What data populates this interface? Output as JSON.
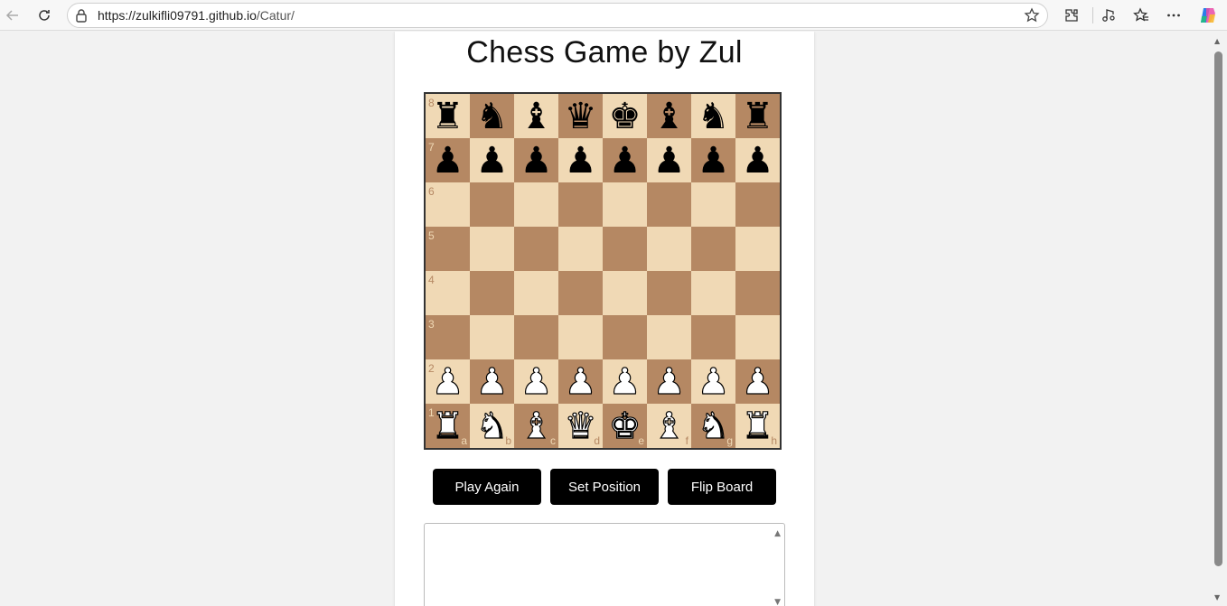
{
  "browser": {
    "url_host": "https://zulkifli09791.github.io",
    "url_path": "/Catur/"
  },
  "page": {
    "title": "Chess Game by Zul"
  },
  "board": {
    "rank_labels": [
      "8",
      "7",
      "6",
      "5",
      "4",
      "3",
      "2",
      "1"
    ],
    "file_labels": [
      "a",
      "b",
      "c",
      "d",
      "e",
      "f",
      "g",
      "h"
    ],
    "position": [
      [
        "bR",
        "bN",
        "bB",
        "bQ",
        "bK",
        "bB",
        "bN",
        "bR"
      ],
      [
        "bP",
        "bP",
        "bP",
        "bP",
        "bP",
        "bP",
        "bP",
        "bP"
      ],
      [
        "",
        "",
        "",
        "",
        "",
        "",
        "",
        ""
      ],
      [
        "",
        "",
        "",
        "",
        "",
        "",
        "",
        ""
      ],
      [
        "",
        "",
        "",
        "",
        "",
        "",
        "",
        ""
      ],
      [
        "",
        "",
        "",
        "",
        "",
        "",
        "",
        ""
      ],
      [
        "wP",
        "wP",
        "wP",
        "wP",
        "wP",
        "wP",
        "wP",
        "wP"
      ],
      [
        "wR",
        "wN",
        "wB",
        "wQ",
        "wK",
        "wB",
        "wN",
        "wR"
      ]
    ],
    "light_color": "#f0d9b5",
    "dark_color": "#b58863"
  },
  "buttons": {
    "play_again": "Play Again",
    "set_position": "Set Position",
    "flip_board": "Flip Board"
  },
  "move_log": {
    "value": ""
  }
}
